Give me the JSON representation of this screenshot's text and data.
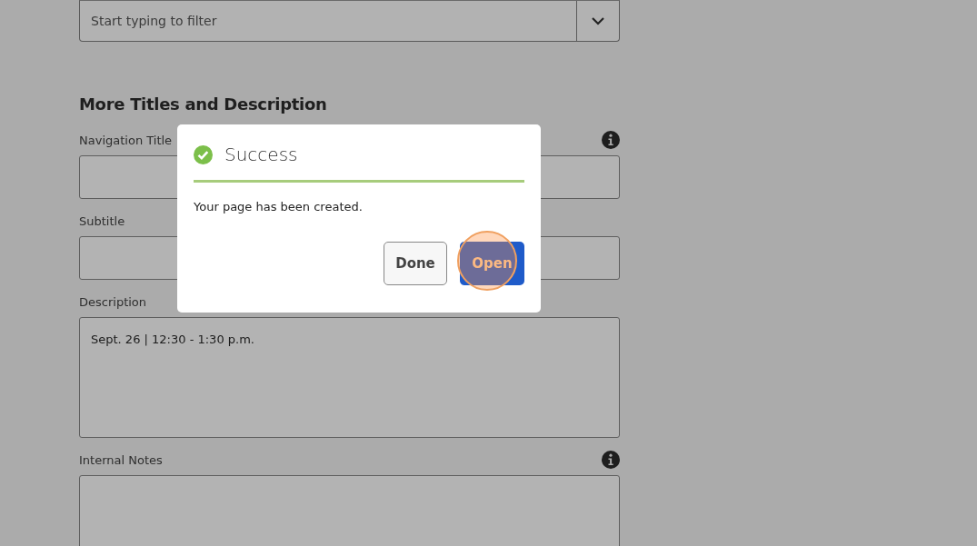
{
  "filter": {
    "placeholder": "Start typing to filter"
  },
  "section": {
    "title": "More Titles and Description"
  },
  "fields": [
    {
      "label": "Navigation Title",
      "kind": "input",
      "info": true
    },
    {
      "label": "Subtitle",
      "kind": "input",
      "info": false
    },
    {
      "label": "Description",
      "kind": "textarea",
      "info": false,
      "value": "Sept. 26 | 12:30 - 1:30 p.m."
    },
    {
      "label": "Internal Notes",
      "kind": "textarea",
      "info": true
    }
  ],
  "dialog": {
    "title": "Success",
    "message": "Your page has been created.",
    "buttons": [
      {
        "label": "Done",
        "kind": "secondary",
        "highlighted": false
      },
      {
        "label": "Open",
        "kind": "primary",
        "highlighted": true
      }
    ]
  }
}
